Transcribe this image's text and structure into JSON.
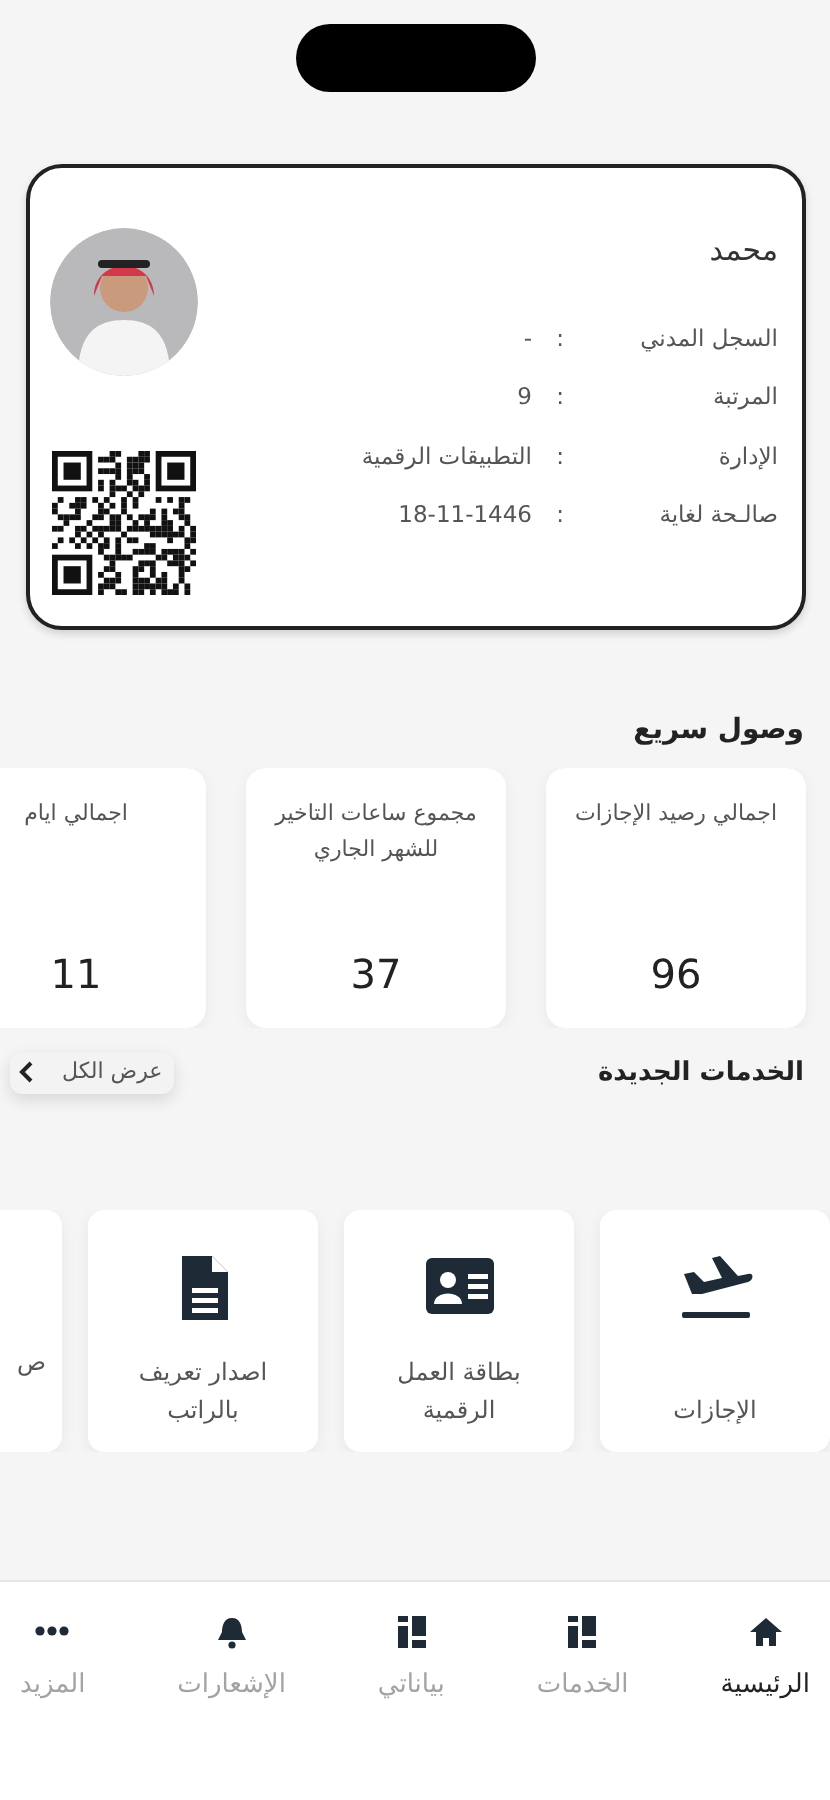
{
  "id_card": {
    "name": "محمد",
    "fields": [
      {
        "label": "السجل المدني",
        "separator": ":",
        "value": "-"
      },
      {
        "label": "المرتبة",
        "separator": ":",
        "value": "9"
      },
      {
        "label": "الإدارة",
        "separator": ":",
        "value": "التطبيقات الرقمية"
      },
      {
        "label": "صالـحة لغاية",
        "separator": ":",
        "value": "18-11-1446"
      }
    ]
  },
  "quick_access": {
    "title": "وصول سريع",
    "stats": [
      {
        "label": "اجمالي رصيد الإجازات",
        "value": "96"
      },
      {
        "label": "مجموع ساعات التاخير للشهر الجاري",
        "value": "37"
      },
      {
        "label": "اجمالي ايام",
        "value": "11"
      }
    ]
  },
  "new_services": {
    "title": "الخدمات الجديدة",
    "view_all": "عرض الكل",
    "items": [
      {
        "label": "الإجازات"
      },
      {
        "label": "بطاقة العمل الرقمية"
      },
      {
        "label": "اصدار تعريف بالراتب"
      },
      {
        "label": "ص"
      }
    ]
  },
  "bottom_nav": [
    {
      "label": "الرئيسية",
      "selected": true
    },
    {
      "label": "الخدمات",
      "selected": false
    },
    {
      "label": "بياناتي",
      "selected": false
    },
    {
      "label": "الإشعارات",
      "selected": false
    },
    {
      "label": "المزيد",
      "selected": false
    }
  ]
}
